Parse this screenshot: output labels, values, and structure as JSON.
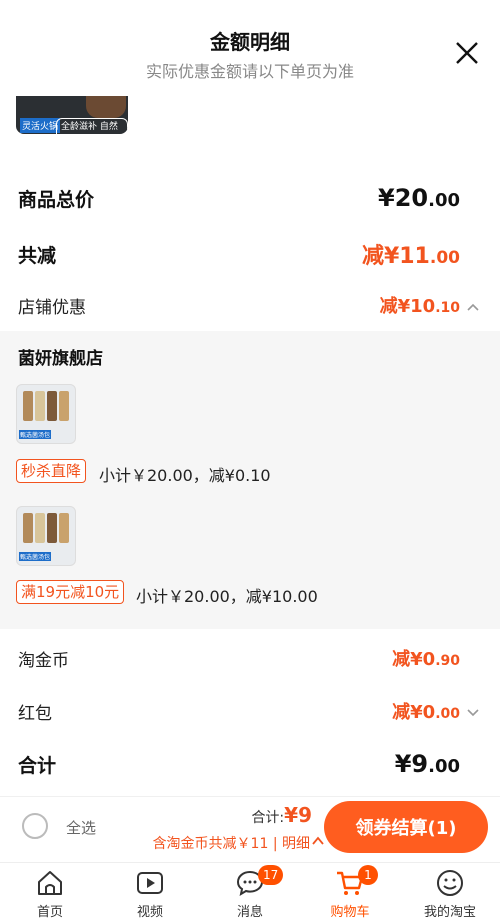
{
  "header": {
    "title": "金额明细",
    "subtitle": "实际优惠金额请以下单页为准"
  },
  "top_thumb": {
    "tag1": "灵活火锅",
    "tag2": "全龄滋补 自然味道"
  },
  "summary": {
    "goods_total_label": "商品总价",
    "goods_total_int": "¥20",
    "goods_total_dec": ".00",
    "total_reduce_label": "共减",
    "total_reduce_int": "减¥11",
    "total_reduce_dec": ".00",
    "store_discount_label": "店铺优惠",
    "store_discount_int": "减¥10",
    "store_discount_dec": ".10"
  },
  "store": {
    "name": "菌妍旗舰店",
    "items": [
      {
        "tag": "秒杀直降",
        "subtotal": "小计￥20.00，减¥0.10",
        "img_title": "甄选菌汤包"
      },
      {
        "tag": "满19元减10元",
        "subtotal": "小计￥20.00，减¥10.00",
        "img_title": "甄选菌汤包"
      }
    ]
  },
  "extras": {
    "coin_label": "淘金币",
    "coin_int": "减¥0",
    "coin_dec": ".90",
    "redpacket_label": "红包",
    "redpacket_int": "减¥0",
    "redpacket_dec": ".00",
    "sum_label": "合计",
    "sum_int": "¥9",
    "sum_dec": ".00"
  },
  "bottom_bar": {
    "select_all": "全选",
    "total_label": "合计:",
    "total_amount": "¥9",
    "saving_text": "含淘金币共减￥11 | 明细",
    "checkout": "领券结算(1)"
  },
  "tabbar": [
    {
      "label": "首页",
      "icon": "home-icon"
    },
    {
      "label": "视频",
      "icon": "video-icon"
    },
    {
      "label": "消息",
      "icon": "message-icon",
      "badge": "17"
    },
    {
      "label": "购物车",
      "icon": "cart-icon",
      "badge": "1",
      "active": true
    },
    {
      "label": "我的淘宝",
      "icon": "profile-icon"
    }
  ],
  "colors": {
    "accent": "#ff5000",
    "discount": "#f2541f"
  }
}
